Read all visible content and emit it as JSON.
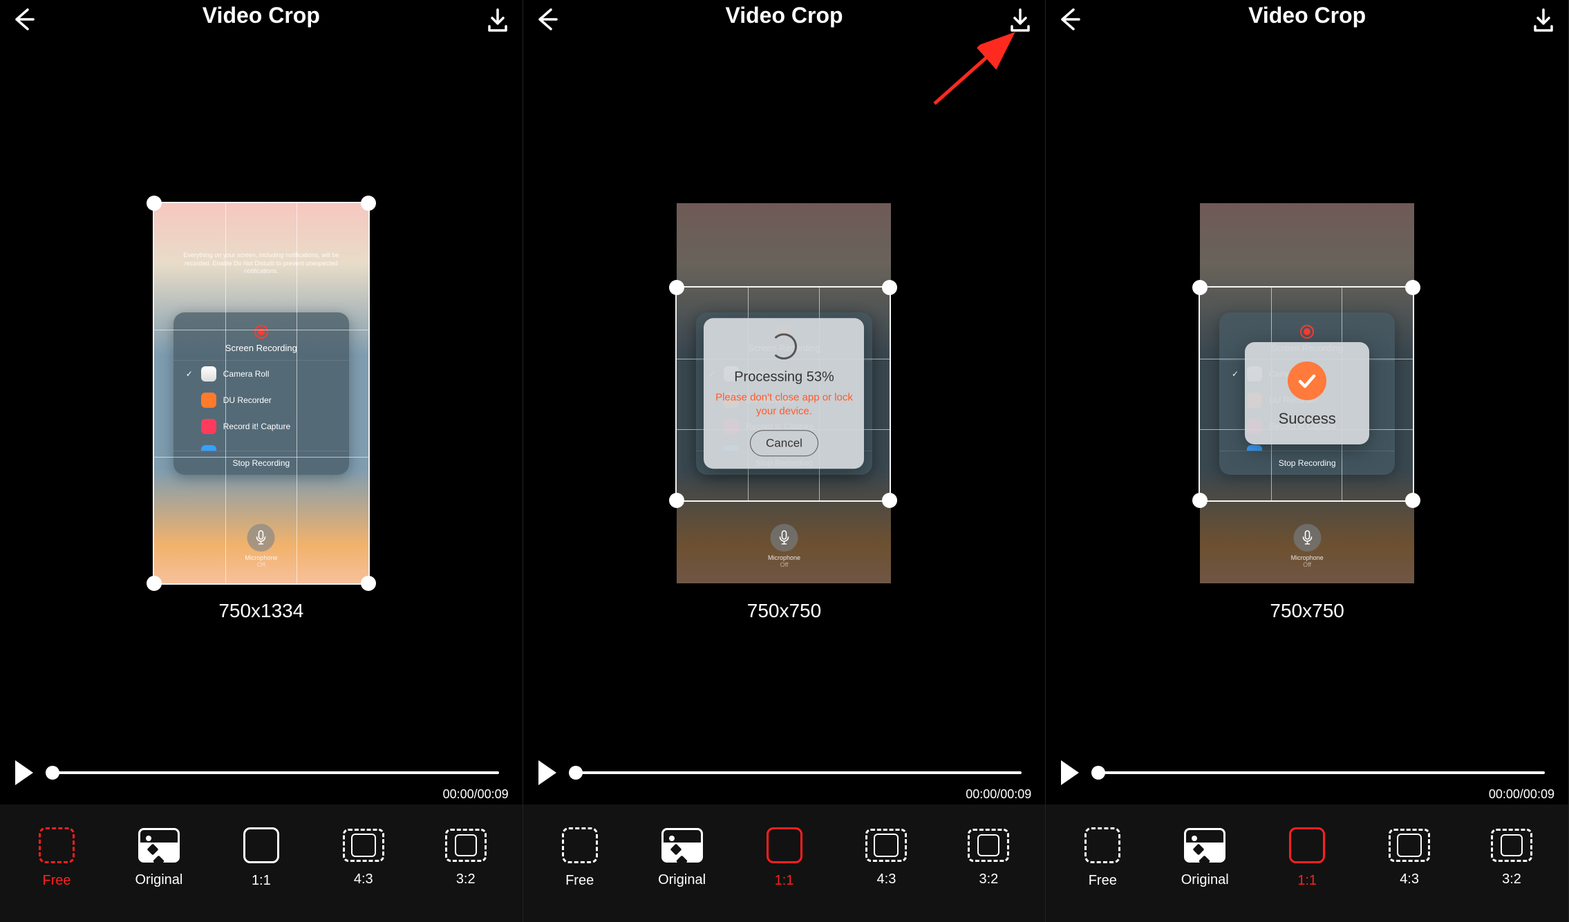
{
  "screens": [
    {
      "title": "Video Crop",
      "dimensions_label": "750x1334",
      "timecode": "00:00/00:09",
      "active_ratio": "free",
      "crop": {
        "square": false
      }
    },
    {
      "title": "Video Crop",
      "dimensions_label": "750x750",
      "timecode": "00:00/00:09",
      "active_ratio": "1_1",
      "crop": {
        "square": true
      },
      "modal": {
        "type": "processing",
        "title": "Processing 53%",
        "warning": "Please don't close app or lock your device.",
        "cancel": "Cancel"
      },
      "arrow": true
    },
    {
      "title": "Video Crop",
      "dimensions_label": "750x750",
      "timecode": "00:00/00:09",
      "active_ratio": "1_1",
      "crop": {
        "square": true
      },
      "modal": {
        "type": "success",
        "title": "Success"
      }
    }
  ],
  "ratio_options": {
    "free": "Free",
    "original": "Original",
    "1_1": "1:1",
    "4_3": "4:3",
    "3_2": "3:2"
  },
  "preview_card": {
    "title": "Screen Recording",
    "items": [
      {
        "label": "Camera Roll",
        "checked": true,
        "color": "white"
      },
      {
        "label": "DU Recorder",
        "checked": false,
        "color": "orange"
      },
      {
        "label": "Record it! Capture",
        "checked": false,
        "color": "red"
      }
    ],
    "stop": "Stop Recording",
    "mic_label": "Microphone",
    "mic_state": "Off"
  }
}
